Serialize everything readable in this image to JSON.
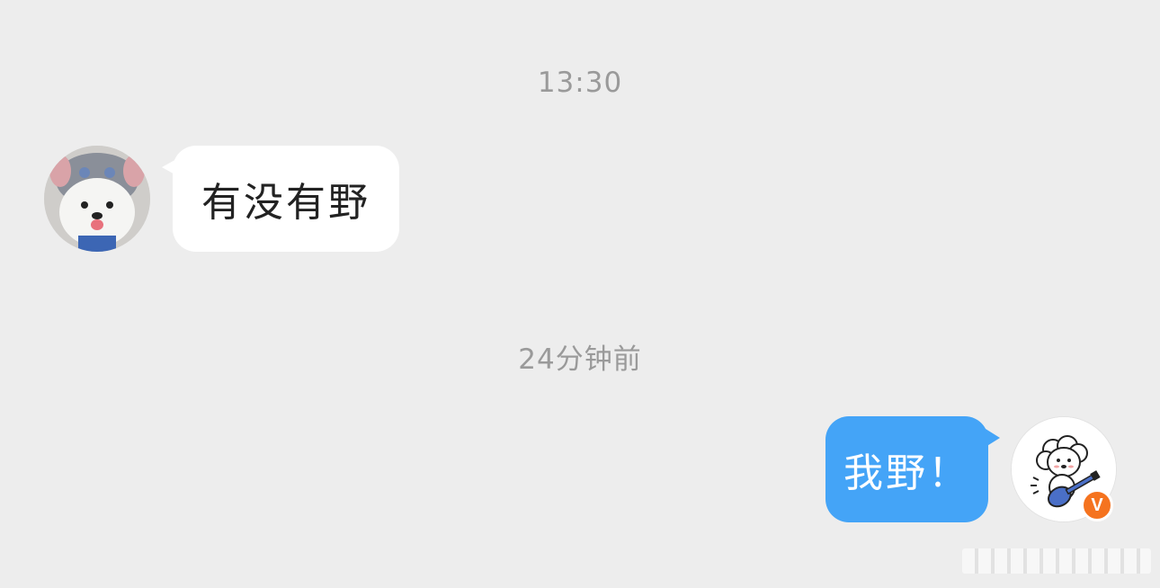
{
  "chat": {
    "timestamps": [
      "13:30",
      "24分钟前"
    ],
    "messages": [
      {
        "direction": "incoming",
        "text": "有没有野"
      },
      {
        "direction": "outgoing",
        "text": "我野！"
      }
    ],
    "verified_badge": "V"
  },
  "colors": {
    "background": "#ededed",
    "incoming_bubble": "#ffffff",
    "outgoing_bubble": "#44a4f7",
    "timestamp_text": "#9a9a9a",
    "badge": "#f5731f"
  },
  "icons": {
    "left_avatar": "samoyed-dog-avatar",
    "right_avatar": "cartoon-dog-guitar-avatar",
    "badge": "verified-v-badge-icon"
  }
}
